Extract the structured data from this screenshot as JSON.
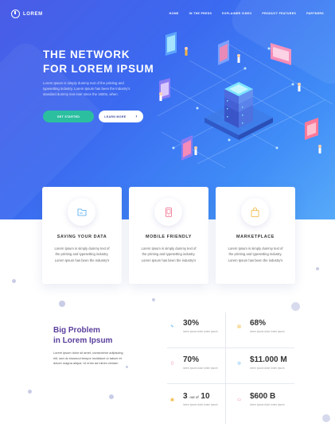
{
  "brand": {
    "name": "LOREM",
    "icon": "clock-icon"
  },
  "nav": [
    "HOME",
    "IN THE PRESS",
    "EXPLAINER VIDEO",
    "PRODUCT FEATURES",
    "PARTNERS"
  ],
  "hero": {
    "title": "THE NETWORK\nFOR LOREM IPSUM",
    "description": "Lorem Ipsum is simply dummy text of the printing and typesetting industry. Lorem Ipsum has been the industry's standard dummy text ever since the 1500s, when",
    "cta_primary": "GET STARTED",
    "cta_secondary": "LEARN MORE"
  },
  "features": [
    {
      "icon": "folder-icon",
      "title": "SAVING YOUR DATA",
      "description": "Lorem Ipsum is simply dummy text of the printing and typesetting industry. Lorem Ipsum has been the industry's",
      "color": "#4aa8f0"
    },
    {
      "icon": "mobile-icon",
      "title": "MOBILE FRIENDLY",
      "description": "Lorem Ipsum is simply dummy text of the printing and typesetting industry. Lorem Ipsum has been the industry's",
      "color": "#f06a8a"
    },
    {
      "icon": "bag-icon",
      "title": "MARKETPLACE",
      "description": "Lorem Ipsum is simply dummy text of the printing and typesetting industry. Lorem Ipsum has been the industry's",
      "color": "#f2b230"
    }
  ],
  "big_problem": {
    "title": "Big Problem\nin Lorem Ipsum",
    "description": "Lorem ipsum dolor sit amet, consectetur adipiscing elit, sed do eiusmod tempor incididunt ut labore et dolore magna aliqua. Ut enim ad minim veniam"
  },
  "stats": [
    {
      "icon": "pen-icon",
      "value": "30%",
      "label": "lorem ipsum dolor lorem ipsum",
      "color": "#4aa8f0"
    },
    {
      "icon": "clipboard-icon",
      "value": "68%",
      "label": "lorem ipsum dolor lorem ipsum",
      "color": "#f2b230"
    },
    {
      "icon": "phone-icon",
      "value": "70%",
      "label": "lorem ipsum dolor lorem ipsum",
      "color": "#f06a8a"
    },
    {
      "icon": "dollar-icon",
      "value": "$11.000 M",
      "label": "lorem ipsum dolor lorem ipsum",
      "color": "#4aa8f0"
    },
    {
      "icon": "star-icon",
      "value": "3",
      "value_suffix": "out of",
      "value_total": "10",
      "label": "lorem ipsum dolor lorem ipsum",
      "color": "#f2b230"
    },
    {
      "icon": "card-icon",
      "value": "$600 B",
      "label": "lorem ipsum dolor lorem ipsum",
      "color": "#f06a8a"
    }
  ]
}
